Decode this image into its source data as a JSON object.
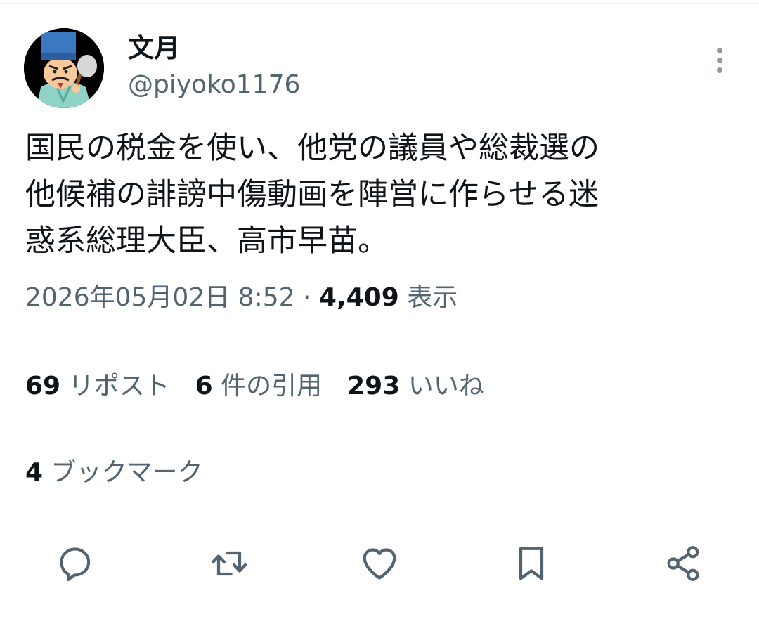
{
  "author": {
    "display_name": "文月",
    "handle": "@piyoko1176"
  },
  "tweet": {
    "lines": [
      "国民の税金を使い、他党の議員や総裁選の",
      "他候補の誹謗中傷動画を陣営に作らせる迷",
      "惑系総理大臣、高市早苗。"
    ],
    "timestamp": "2026年05月02日 8:52",
    "separator": "·",
    "views_count": "4,409",
    "views_label": "表示"
  },
  "stats": {
    "reposts_count": "69",
    "reposts_label": "リポスト",
    "quotes_count": "6",
    "quotes_label": "件の引用",
    "likes_count": "293",
    "likes_label": "いいね",
    "bookmarks_count": "4",
    "bookmarks_label": "ブックマーク"
  },
  "actions": {
    "icons": [
      "reply-icon",
      "repost-icon",
      "like-icon",
      "bookmark-icon",
      "share-icon"
    ]
  },
  "colors": {
    "text_primary": "#0f1419",
    "text_secondary": "#536471",
    "divider": "#e6eaec"
  }
}
